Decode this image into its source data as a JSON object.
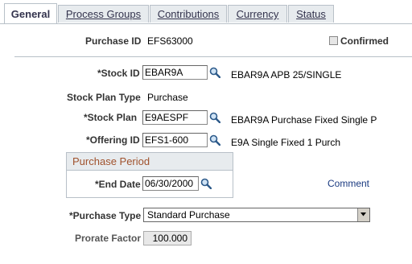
{
  "tabs": [
    {
      "label": "General",
      "active": true
    },
    {
      "label": "Process Groups",
      "active": false
    },
    {
      "label": "Contributions",
      "active": false
    },
    {
      "label": "Currency",
      "active": false
    },
    {
      "label": "Status",
      "active": false
    }
  ],
  "header": {
    "purchase_id_label": "Purchase ID",
    "purchase_id_value": "EFS63000",
    "confirmed_label": "Confirmed",
    "confirmed_checked": false
  },
  "form": {
    "stock_id_label": "*Stock ID",
    "stock_id_value": "EBAR9A",
    "stock_id_desc": "EBAR9A APB 25/SINGLE",
    "stock_plan_type_label": "Stock Plan Type",
    "stock_plan_type_value": "Purchase",
    "stock_plan_label": "*Stock Plan",
    "stock_plan_value": "E9AESPF",
    "stock_plan_desc": "EBAR9A Purchase Fixed Single P",
    "offering_id_label": "*Offering ID",
    "offering_id_value": "EFS1-600",
    "offering_id_desc": "E9A Single Fixed 1 Purch",
    "purchase_period_title": "Purchase Period",
    "end_date_label": "*End Date",
    "end_date_value": "06/30/2000",
    "comment_link": "Comment",
    "purchase_type_label": "*Purchase Type",
    "purchase_type_value": "Standard Purchase",
    "prorate_factor_label": "Prorate Factor",
    "prorate_factor_value": "100.000"
  },
  "colors": {
    "tab_bg": "#e7ebee",
    "border": "#b8c0c8",
    "group_title": "#a0522d",
    "link": "#1a3a80"
  }
}
